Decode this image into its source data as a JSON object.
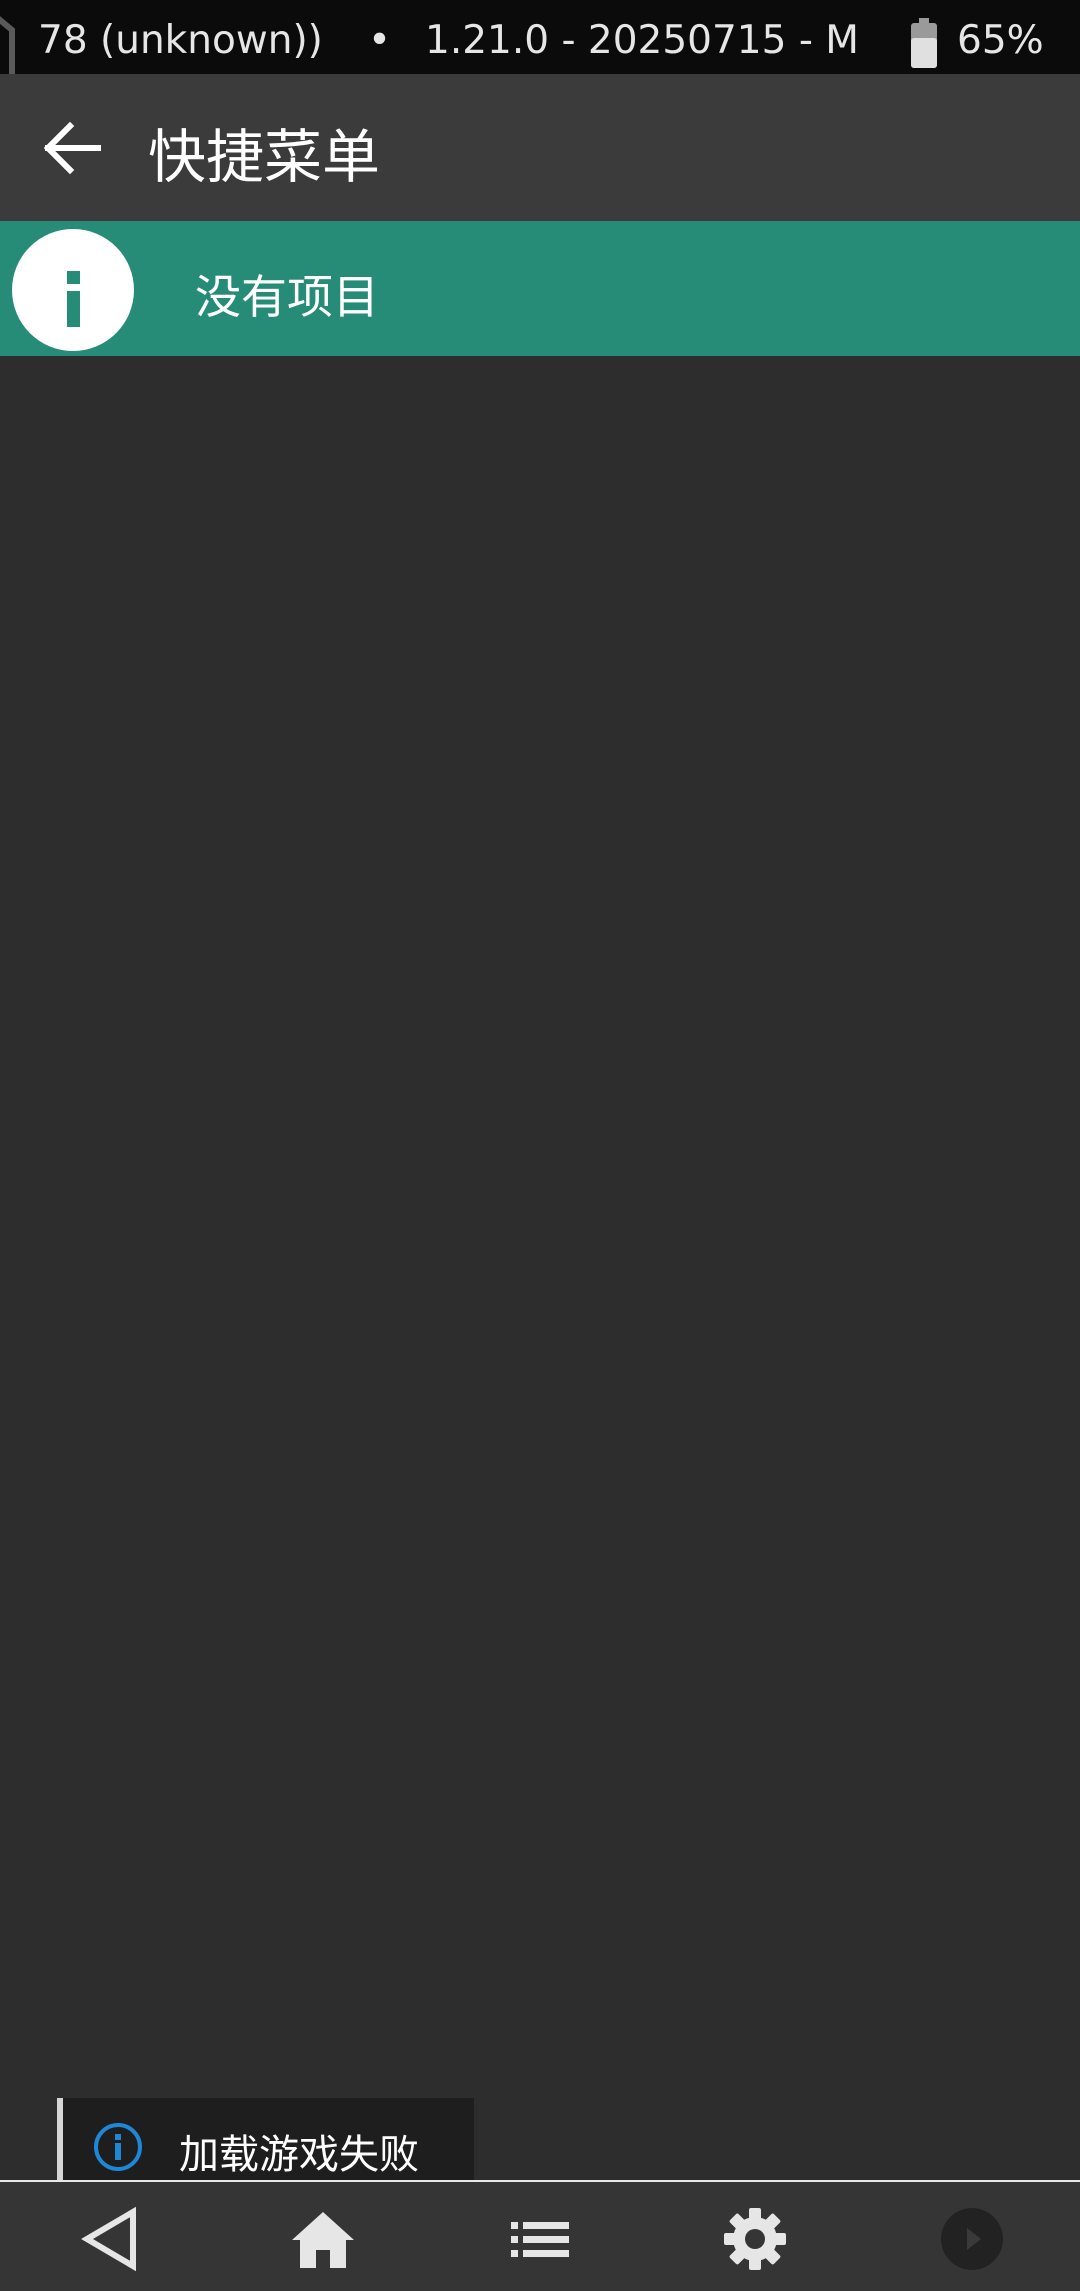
{
  "status_bar": {
    "left_text": "78 (unknown))",
    "separator": "•",
    "build_text": "1.21.0 - 20250715 - M",
    "battery_icon": "battery-icon",
    "battery_percent": "65%"
  },
  "toolbar": {
    "back_icon": "arrow-left-icon",
    "title": "快捷菜单"
  },
  "info_banner": {
    "icon": "info-icon",
    "text": "没有项目",
    "background": "#268c77"
  },
  "toast": {
    "icon": "info-icon",
    "text": "加载游戏失败",
    "icon_color": "#1e88d6"
  },
  "bottom_nav": {
    "items": [
      {
        "icon": "back-triangle-icon"
      },
      {
        "icon": "home-icon"
      },
      {
        "icon": "list-icon"
      },
      {
        "icon": "gear-icon"
      },
      {
        "icon": "play-circle-icon"
      }
    ]
  }
}
